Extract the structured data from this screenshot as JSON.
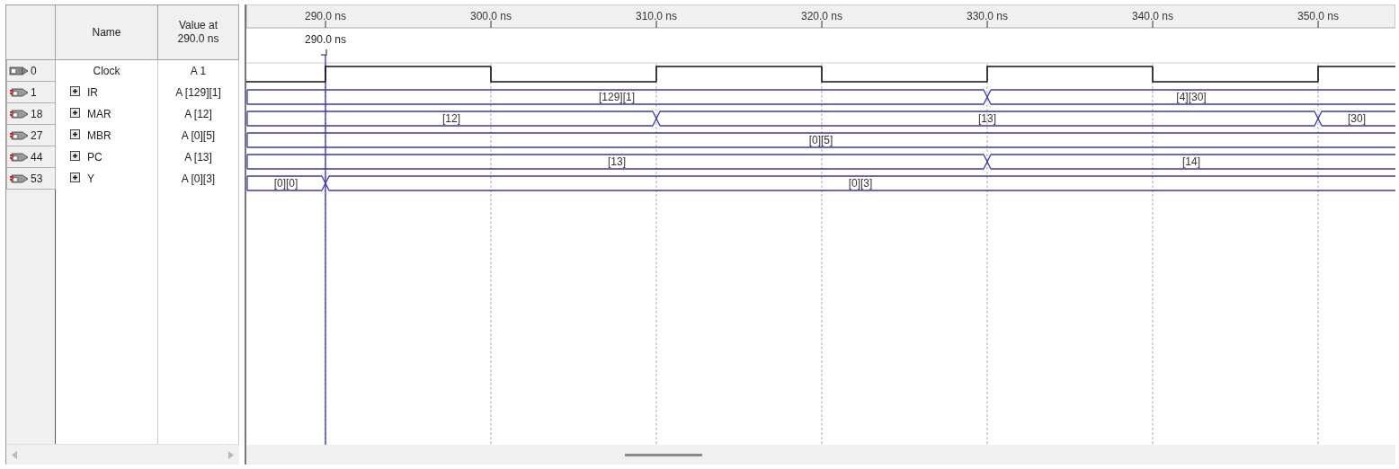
{
  "columns": {
    "name": "Name",
    "value": "Value at 290.0 ns"
  },
  "ruler": {
    "ticks": [
      "290.0 ns",
      "300.0 ns",
      "310.0 ns",
      "320.0 ns",
      "330.0 ns",
      "340.0 ns",
      "350.0 ns"
    ]
  },
  "cursor": {
    "label": "290.0 ns"
  },
  "signals": [
    {
      "index": "0",
      "kind": "clock",
      "name": "Clock",
      "value": "A 1",
      "intervals": [
        {
          "high": false
        },
        {
          "high": true
        },
        {
          "high": false
        },
        {
          "high": true
        },
        {
          "high": false
        },
        {
          "high": true
        },
        {
          "high": false
        },
        {
          "high": true
        }
      ]
    },
    {
      "index": "1",
      "kind": "bus",
      "name": "IR",
      "value": "A [129][1]",
      "expanded": false,
      "segments": [
        "[129][1]",
        "[4][30]"
      ],
      "intervals": [
        {
          "change": false
        },
        {
          "change": false
        },
        {
          "change": false
        },
        {
          "change": false
        },
        {
          "change": false
        },
        {
          "change": true
        },
        {
          "change": false
        },
        {
          "change": false
        }
      ]
    },
    {
      "index": "18",
      "kind": "bus",
      "name": "MAR",
      "value": "A [12]",
      "expanded": false,
      "segments": [
        "[12]",
        "[13]",
        "[30]"
      ],
      "intervals": [
        {
          "change": false
        },
        {
          "change": false
        },
        {
          "change": false
        },
        {
          "change": true
        },
        {
          "change": false
        },
        {
          "change": false
        },
        {
          "change": false
        },
        {
          "change": true
        }
      ]
    },
    {
      "index": "27",
      "kind": "bus",
      "name": "MBR",
      "value": "A [0][5]",
      "expanded": false,
      "segments": [
        "[0][5]"
      ],
      "intervals": [
        {
          "change": false
        },
        {
          "change": false
        },
        {
          "change": false
        },
        {
          "change": false
        },
        {
          "change": false
        },
        {
          "change": false
        },
        {
          "change": false
        },
        {
          "change": false
        }
      ]
    },
    {
      "index": "44",
      "kind": "bus",
      "name": "PC",
      "value": "A [13]",
      "expanded": false,
      "segments": [
        "[13]",
        "[14]"
      ],
      "intervals": [
        {
          "change": false
        },
        {
          "change": false
        },
        {
          "change": false
        },
        {
          "change": false
        },
        {
          "change": false
        },
        {
          "change": true
        },
        {
          "change": false
        },
        {
          "change": false
        }
      ]
    },
    {
      "index": "53",
      "kind": "bus",
      "name": "Y",
      "value": "A [0][3]",
      "expanded": false,
      "segments": [
        "[0][0]",
        "[0][3]"
      ],
      "intervals": [
        {
          "change": false
        },
        {
          "change": true
        },
        {
          "change": false
        },
        {
          "change": false
        },
        {
          "change": false
        },
        {
          "change": false
        },
        {
          "change": false
        },
        {
          "change": false
        }
      ]
    }
  ]
}
